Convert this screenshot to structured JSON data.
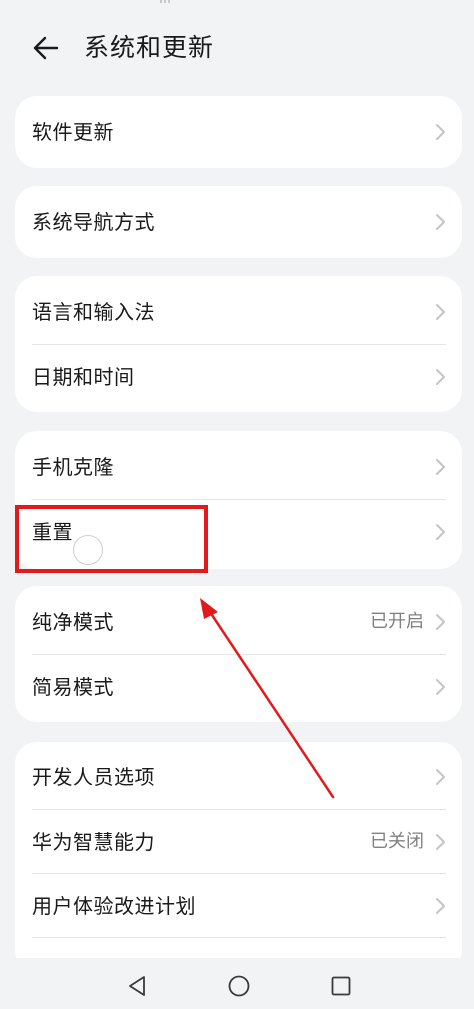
{
  "header": {
    "title": "系统和更新",
    "back_icon": "arrow-left-icon"
  },
  "groups": [
    {
      "items": [
        {
          "label": "软件更新",
          "value": ""
        }
      ]
    },
    {
      "items": [
        {
          "label": "系统导航方式",
          "value": ""
        }
      ]
    },
    {
      "items": [
        {
          "label": "语言和输入法",
          "value": ""
        },
        {
          "label": "日期和时间",
          "value": ""
        }
      ]
    },
    {
      "items": [
        {
          "label": "手机克隆",
          "value": ""
        },
        {
          "label": "重置",
          "value": ""
        }
      ]
    },
    {
      "items": [
        {
          "label": "纯净模式",
          "value": "已开启"
        },
        {
          "label": "简易模式",
          "value": ""
        }
      ]
    },
    {
      "items": [
        {
          "label": "开发人员选项",
          "value": ""
        },
        {
          "label": "华为智慧能力",
          "value": "已关闭"
        },
        {
          "label": "用户体验改进计划",
          "value": ""
        }
      ]
    }
  ],
  "navbar": {
    "back": "triangle-back-icon",
    "home": "circle-home-icon",
    "recent": "square-recent-icon"
  },
  "annotation": {
    "highlight_color": "#e11b1b",
    "highlighted_item": "重置"
  },
  "colors": {
    "background": "#f1f3f5",
    "card": "#ffffff",
    "secondary_text": "#808080",
    "chevron": "#c4c4c4"
  }
}
